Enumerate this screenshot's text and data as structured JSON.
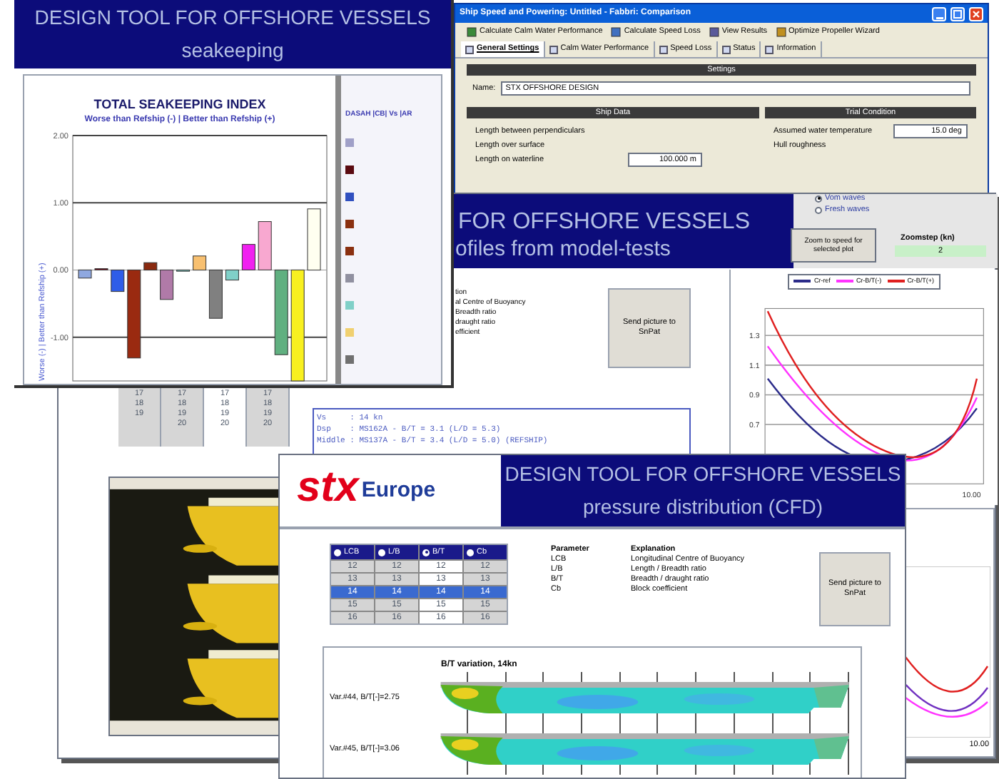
{
  "powering_window": {
    "title": "Ship Speed and Powering: Untitled - Fabbri: Comparison",
    "toolbar": [
      "Calculate Calm Water Performance",
      "Calculate Speed Loss",
      "View Results",
      "Optimize Propeller Wizard"
    ],
    "tabs": [
      {
        "label": "General Settings",
        "selected": true
      },
      {
        "label": "Calm Water Performance",
        "selected": false
      },
      {
        "label": "Speed Loss",
        "selected": false
      },
      {
        "label": "Status",
        "selected": false
      },
      {
        "label": "Information",
        "selected": false
      }
    ],
    "settings": {
      "heading": "Settings",
      "name_label": "Name:",
      "name_value": "STX OFFSHORE DESIGN"
    },
    "ship_data": {
      "heading": "Ship Data",
      "rows": [
        {
          "label": "Length between perpendiculars"
        },
        {
          "label": "Length over surface"
        },
        {
          "label": "Length on waterline",
          "value": "100.000 m"
        }
      ]
    },
    "trial_condition": {
      "heading": "Trial Condition",
      "rows": [
        {
          "label": "Assumed water temperature",
          "value": "15.0 deg"
        },
        {
          "label": "Hull roughness"
        }
      ]
    }
  },
  "model_tests_window": {
    "title_part": "FOR OFFSHORE VESSELS",
    "subtitle_part": "ofiles from model-tests",
    "wave_options": [
      {
        "label": "Vom waves",
        "selected": true
      },
      {
        "label": "Fresh waves",
        "selected": false
      }
    ],
    "zoom_button": "Zoom to speed for selected plot",
    "zoomstep_label": "Zoomstep (kn)",
    "zoomstep_value": "2",
    "explanations": [
      "tion",
      "al Centre of Buoyancy",
      "Breadth ratio",
      "draught ratio",
      "efficient"
    ],
    "send_button": "Send picture to SnPat",
    "x_axis_end_label": "10.00",
    "line_chart": {
      "y_tick_labels": [
        "1.3",
        "1.1",
        "0.9",
        "0.7"
      ],
      "legend": [
        {
          "name": "Cr-ref",
          "color": "#2b2b8a"
        },
        {
          "name": "Cr-B/T(-)",
          "color": "#ff33ff"
        },
        {
          "name": "Cr-B/T(+)",
          "color": "#e02020"
        }
      ]
    },
    "info_lines": [
      "Vs     : 14 kn",
      "Dsp    : MS162A - B/T = 3.1 (L/D = 5.3)",
      "Middle : MS137A - B/T = 3.4 (L/D = 5.0) (REFSHIP)"
    ],
    "table_columns": [
      [
        "17",
        "18",
        "19"
      ],
      [
        "17",
        "18",
        "19",
        "20"
      ],
      [
        "17",
        "18",
        "19",
        "20"
      ],
      [
        "17",
        "18",
        "19",
        "20"
      ]
    ],
    "photo": {
      "kind": "picture"
    },
    "lower_chart": {
      "xtick": "10.00"
    }
  },
  "seakeeping_window": {
    "title": "DESIGN TOOL FOR OFFSHORE VESSELS",
    "subtitle": "seakeeping",
    "chart_subtitle": "Worse than Refship (-) | Better than Refship (+)",
    "chart_data": {
      "type": "bar",
      "title": "TOTAL SEAKEEPING INDEX",
      "ylabel": "Worse (-) | Better than Refship (+)",
      "ylim": [
        -1.65,
        2
      ],
      "yticks": [
        {
          "value": 2,
          "label": "2.00"
        },
        {
          "value": 1,
          "label": "1.00"
        },
        {
          "value": 0,
          "label": "0.00"
        },
        {
          "value": -1,
          "label": "-1.00"
        }
      ],
      "series": [
        {
          "color": "#8fa8e0",
          "values": [
            -0.12
          ]
        },
        {
          "color": "#7a1020",
          "values": [
            0.02
          ]
        },
        {
          "color": "#2f5de8",
          "values": [
            -0.32
          ]
        },
        {
          "color": "#9a2a10",
          "values": [
            -1.31
          ]
        },
        {
          "color": "#8a2a10",
          "values": [
            0.11
          ]
        },
        {
          "color": "#b07aa8",
          "values": [
            -0.44
          ]
        },
        {
          "color": "#7ac8c0",
          "values": [
            -0.02
          ]
        },
        {
          "color": "#f8c070",
          "values": [
            0.21
          ]
        },
        {
          "color": "#808080",
          "values": [
            -0.72
          ]
        },
        {
          "color": "#80d0c8",
          "values": [
            -0.15
          ]
        },
        {
          "color": "#f020f0",
          "values": [
            0.38
          ]
        },
        {
          "color": "#f8a8d0",
          "values": [
            0.72
          ]
        },
        {
          "color": "#60b080",
          "values": [
            -1.26
          ]
        },
        {
          "color": "#f8f020",
          "values": [
            -1.65
          ]
        },
        {
          "color": "#fffff0",
          "values": [
            0.91
          ]
        }
      ]
    },
    "legend": {
      "header": "DASAH |CB| Vs |AR",
      "entries": [
        {
          "color": "#a0a0c8"
        },
        {
          "color": "#5a0a10"
        },
        {
          "color": "#3050c0"
        },
        {
          "color": "#8a3010"
        },
        {
          "color": "#8a3010"
        },
        {
          "color": "#9090a0"
        },
        {
          "color": "#80d0c8"
        },
        {
          "color": "#f0d070"
        },
        {
          "color": "#707070"
        }
      ]
    }
  },
  "cfd_window": {
    "logo_mark": "stx",
    "logo_word": "Europe",
    "title": "DESIGN TOOL FOR OFFSHORE VESSELS",
    "subtitle": "pressure distribution (CFD)",
    "table": {
      "columns": [
        {
          "label": "LCB",
          "selected": false
        },
        {
          "label": "L/B",
          "selected": false
        },
        {
          "label": "B/T",
          "selected": true
        },
        {
          "label": "Cb",
          "selected": false
        }
      ],
      "rows": [
        {
          "cells": [
            "12",
            "12",
            "12",
            "12"
          ],
          "selected": false
        },
        {
          "cells": [
            "13",
            "13",
            "13",
            "13"
          ],
          "selected": false
        },
        {
          "cells": [
            "14",
            "14",
            "14",
            "14"
          ],
          "selected": true
        },
        {
          "cells": [
            "15",
            "15",
            "15",
            "15"
          ],
          "selected": false
        },
        {
          "cells": [
            "16",
            "16",
            "16",
            "16"
          ],
          "selected": false
        }
      ]
    },
    "parameters": {
      "headers": [
        "Parameter",
        "Explanation"
      ],
      "rows": [
        [
          "LCB",
          "Longitudinal Centre of Buoyancy"
        ],
        [
          "L/B",
          "Length / Breadth ratio"
        ],
        [
          "B/T",
          "Breadth / draught ratio"
        ],
        [
          "Cb",
          "Block coefficient"
        ]
      ]
    },
    "send_button": "Send picture to SnPat",
    "panel_title": "B/T variation, 14kn",
    "variants": [
      {
        "label": "Var.#44, B/T[-]=2.75"
      },
      {
        "label": "Var.#45, B/T[-]=3.06"
      }
    ]
  }
}
